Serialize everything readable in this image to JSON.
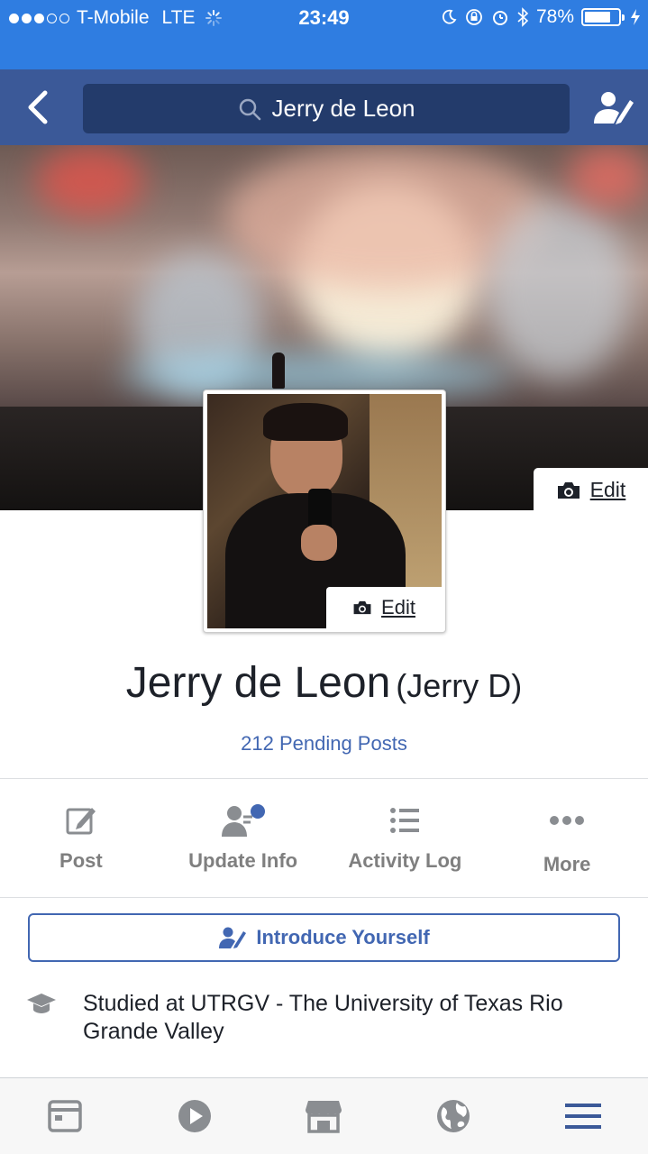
{
  "status_bar": {
    "carrier": "T-Mobile",
    "network": "LTE",
    "time": "23:49",
    "battery_percent": "78%",
    "battery_level": 0.78,
    "signal_bars_filled": 3,
    "signal_bars_total": 5
  },
  "nav": {
    "search_text": "Jerry de Leon",
    "back_icon": "chevron-left-icon",
    "edit_profile_icon": "person-pencil-icon"
  },
  "cover": {
    "edit_label": "Edit"
  },
  "avatar": {
    "edit_label": "Edit"
  },
  "profile": {
    "name": "Jerry de Leon",
    "alternate_name": "(Jerry D)",
    "pending_posts": "212 Pending Posts"
  },
  "actions": [
    {
      "label": "Post",
      "icon": "pencil-square-icon"
    },
    {
      "label": "Update Info",
      "icon": "person-info-icon"
    },
    {
      "label": "Activity Log",
      "icon": "list-icon"
    },
    {
      "label": "More",
      "icon": "more-dots-icon"
    }
  ],
  "intro": {
    "label": "Introduce Yourself"
  },
  "education": {
    "text": "Studied at UTRGV - The University of Texas Rio Grande Valley",
    "icon": "graduation-cap-icon"
  },
  "tabbar": [
    {
      "icon": "news-feed-icon"
    },
    {
      "icon": "video-play-icon"
    },
    {
      "icon": "marketplace-icon"
    },
    {
      "icon": "globe-icon"
    },
    {
      "icon": "menu-icon"
    }
  ],
  "colors": {
    "status_bar": "#2f7de1",
    "nav": "#3b5998",
    "link": "#4267b2"
  }
}
